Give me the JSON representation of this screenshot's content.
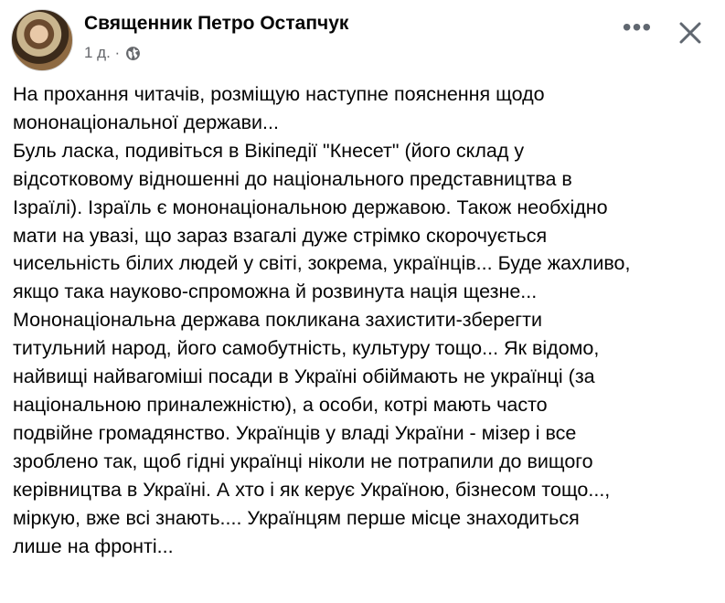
{
  "post": {
    "author": "Священник Петро Остапчук",
    "time": "1 д. ·",
    "privacy_icon": "globe-icon",
    "more_label": "•••",
    "close_icon": "close-icon",
    "lines": [
      "На прохання читачів, розміщую наступне пояснення щодо",
      "мононаціональної держави...",
      "Буль ласка, подивіться в Вікіпедії \"Кнесет\" (його склад у",
      "відсотковому відношенні до національного представництва в",
      "Ізраїлі). Ізраїль є мононаціональною державою. Також необхідно",
      "мати на увазі, що зараз взагалі дуже стрімко скорочується",
      "чисельність білих людей у світі, зокрема, українців... Буде жахливо,",
      "якщо така науково-спроможна й розвинута нація щезне...",
      "Мононаціональна держава покликана захистити-зберегти",
      "титульний народ, його самобутність, культуру тощо... Як відомо,",
      "найвищі найвагоміші посади в Україні обіймають не українці (за",
      "національною приналежністю), а особи, котрі мають часто",
      "подвійне громадянство. Українців у владі України - мізер і все",
      "зроблено так, щоб гідні українці ніколи не потрапили до вищого",
      "керівництва в Україні. А хто і як керує Україною, бізнесом тощо...,",
      "міркую, вже всі знають.... Українцям перше місце знаходиться",
      "лише на фронті..."
    ]
  },
  "colors": {
    "text": "#050505",
    "secondary": "#65676b",
    "icon": "#606770",
    "background": "#ffffff"
  }
}
